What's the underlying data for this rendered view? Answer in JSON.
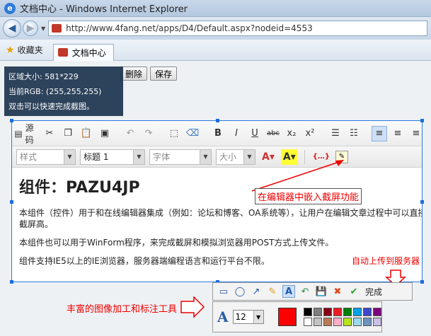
{
  "window": {
    "title": "文档中心 - Windows Internet Explorer",
    "url": "http://www.4fang.net/apps/D4/Default.aspx?nodeid=4553"
  },
  "favorites": {
    "label": "收藏夹",
    "tab_label": "文档中心"
  },
  "page_buttons": {
    "delete": "删除",
    "save": "保存"
  },
  "info": {
    "size_line": "区域大小: 581*229",
    "rgb_line": "当前RGB: (255,255,255)",
    "hint_line": "双击可以快速完成截图。"
  },
  "editor_toolbar": {
    "source_label": "源码",
    "style_placeholder": "样式",
    "heading_value": "标题 1",
    "font_placeholder": "字体",
    "size_placeholder": "大小"
  },
  "content": {
    "heading": "组件：PAZU4JP",
    "paragraphs": [
      "本组件（控件）用于和在线编辑器集成（例如：论坛和博客、OA系统等），让用户在编辑文章过程中可以直接保存截屏高。",
      "本组件也可以用于WinForm程序，来完成截屏和模拟浏览器用POST方式上传文件。",
      "组件支持IE5以上的IE浏览器，服务器端编程语言和运行平台不限。"
    ]
  },
  "annotations": {
    "embed": "在编辑器中嵌入截屏功能",
    "upload": "自动上传到服务器",
    "tools": "丰富的图像加工和标注工具"
  },
  "capture_toolbar": {
    "done_label": "完成"
  },
  "font_toolbar": {
    "size_value": "12",
    "current_color": "#ff0000",
    "palette": [
      "#000000",
      "#7f7f7f",
      "#880015",
      "#ed1c24",
      "#008000",
      "#00a2e8",
      "#3f48cc",
      "#7f007f",
      "#ffffff",
      "#c3c3c3",
      "#b97a57",
      "#ffaec9",
      "#b5e61d",
      "#99d9ea",
      "#7092be",
      "#c8bfe7"
    ]
  }
}
